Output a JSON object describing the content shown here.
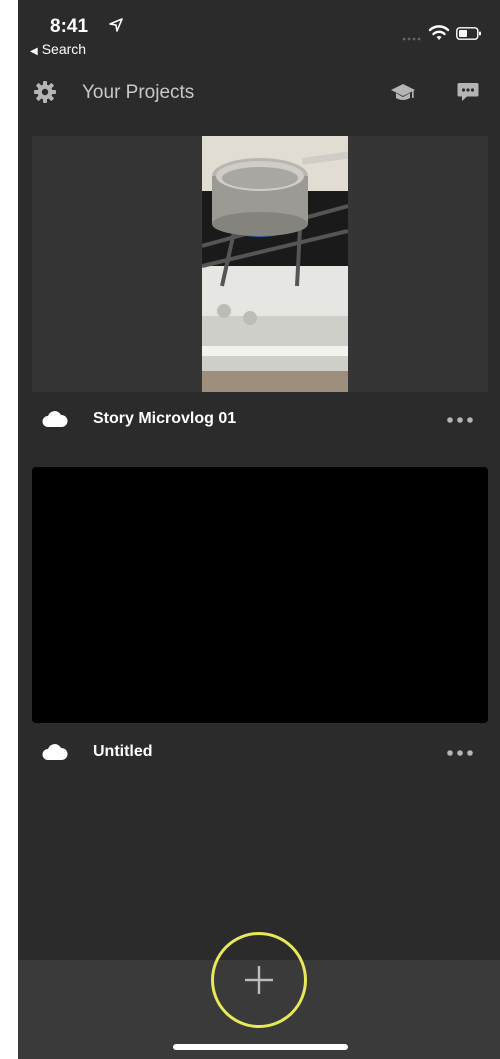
{
  "status_bar": {
    "time": "8:41",
    "back_label": "Search",
    "icons": [
      "location-arrow-icon",
      "signal-icon",
      "wifi-icon",
      "battery-icon"
    ]
  },
  "header": {
    "title": "Your Projects",
    "icons": [
      "gear-icon",
      "graduation-cap-icon",
      "chat-bubble-icon"
    ]
  },
  "projects": [
    {
      "name": "Story Microvlog 01",
      "thumbnail": "cooking-pot-on-stove",
      "sync_icon": "cloud-icon",
      "menu_icon": "more-icon"
    },
    {
      "name": "Untitled",
      "thumbnail": "black",
      "sync_icon": "cloud-icon",
      "menu_icon": "more-icon"
    }
  ],
  "bottom_bar": {
    "add_icon": "plus-icon"
  },
  "colors": {
    "background": "#2b2b2b",
    "card": "#353535",
    "bottom_bar": "#3a3a3a",
    "highlight_ring": "#e8e85a",
    "text": "#ffffff",
    "muted_text": "#c8c8c8"
  }
}
